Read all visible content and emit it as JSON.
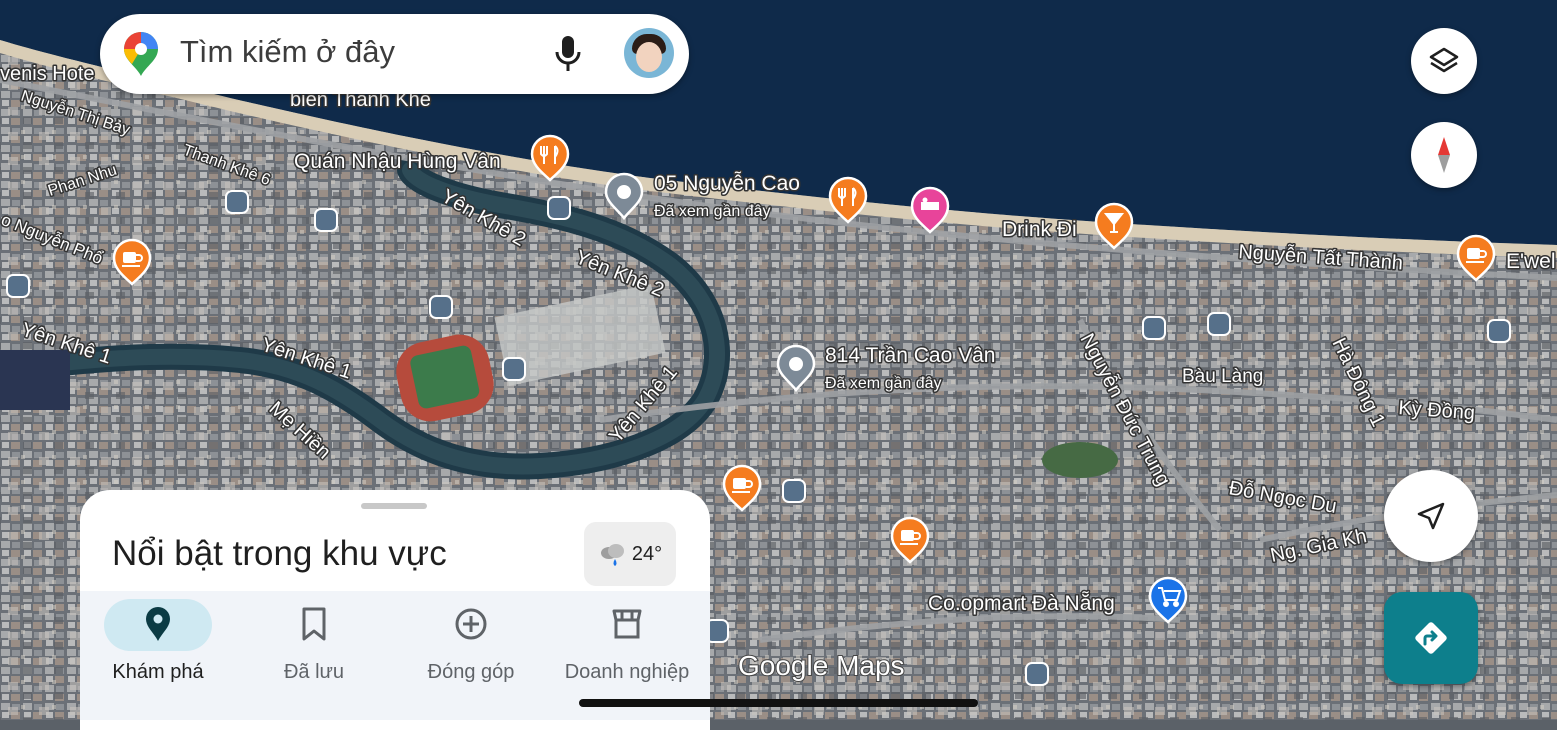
{
  "search": {
    "placeholder": "Tìm kiếm ở đây",
    "mic_icon": "microphone-icon",
    "avatar": "user-avatar"
  },
  "map": {
    "places": [
      {
        "name": "Quán Nhậu Hùng Vân",
        "icon": "restaurant-icon"
      },
      {
        "name": "05 Nguyễn Cao",
        "subtitle": "Đã xem gần đây",
        "icon": "history-pin-icon"
      },
      {
        "name": "Drink Đi",
        "icon": "cocktail-icon"
      },
      {
        "name": "814 Trần Cao Vân",
        "subtitle": "Đã xem gần đây",
        "icon": "history-pin-icon"
      },
      {
        "name": "Co.opmart Đà Nẵng",
        "icon": "shopping-cart-icon"
      },
      {
        "name": "E'wel",
        "icon": "cafe-icon"
      }
    ],
    "roads": [
      "Yên Khê 2",
      "Yên Khê 2",
      "Yên Khê 1",
      "Yên Khê 1",
      "Yên Khê 1",
      "Mẹ Hiền",
      "Nguyễn Tất Thành",
      "Nguyễn Đức Trung",
      "Hà Đông 1",
      "Kỳ Đồng",
      "Bàu Làng",
      "Đỗ Ngọc Du",
      "Ng. Gia Kh",
      "Thanh Khê 6",
      "Phan Nhu",
      "Nguyễn Thị Bảy",
      "o Nguyễn Phổ",
      "venis Hote",
      "biển Thanh Khê"
    ],
    "watermark": "Google Maps"
  },
  "buttons": {
    "layers_icon": "layers-icon",
    "compass_icon": "compass-icon",
    "location_icon": "my-location-icon",
    "directions_icon": "directions-icon"
  },
  "sheet": {
    "title": "Nổi bật trong khu vực",
    "weather": {
      "temp": "24°",
      "icon": "rain-cloud-icon"
    }
  },
  "nav": [
    {
      "label": "Khám phá",
      "icon": "explore-pin-icon",
      "active": true
    },
    {
      "label": "Đã lưu",
      "icon": "bookmark-icon",
      "active": false
    },
    {
      "label": "Đóng góp",
      "icon": "add-circle-icon",
      "active": false
    },
    {
      "label": "Doanh nghiệp",
      "icon": "storefront-icon",
      "active": false
    }
  ],
  "colors": {
    "accent": "#0d7f8c",
    "active_pill": "#cfe9f2",
    "poi_orange": "#f57c1f",
    "poi_pink": "#e8449a",
    "poi_blue": "#1a73e8",
    "sea": "#0f2a4a"
  }
}
